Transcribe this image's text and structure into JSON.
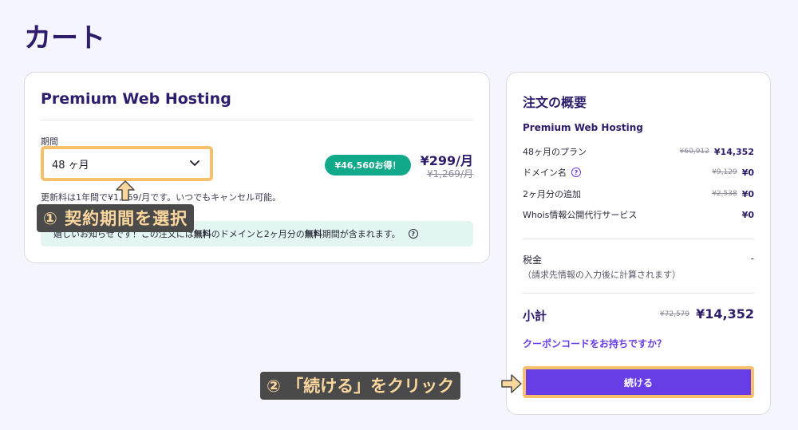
{
  "page": {
    "title": "カート"
  },
  "plan": {
    "title": "Premium Web Hosting",
    "period_label": "期間",
    "period_value": "48 ヶ月",
    "savings_badge": "¥46,560お得！",
    "price_current": "¥299/月",
    "price_original": "¥1,269/月",
    "renewal_note": "更新料は1年間で¥1,269/月です。いつでもキャンセル可能。",
    "banner": {
      "pre": "嬉しいお知らせです！この注文には",
      "bold1": "無料",
      "mid": "のドメインと2ヶ月分の",
      "bold2": "無料",
      "post": "期間が含まれます。"
    }
  },
  "annotations": {
    "step1": "① 契約期間を選択",
    "step2": "② 「続ける」をクリック"
  },
  "summary": {
    "title": "注文の概要",
    "plan_name": "Premium Web Hosting",
    "rows": [
      {
        "label": "48ヶ月のプラン",
        "original": "¥60,912",
        "amount": "¥14,352"
      },
      {
        "label": "ドメイン名",
        "original": "¥9,129",
        "amount": "¥0"
      },
      {
        "label": "2ヶ月分の追加",
        "original": "¥2,538",
        "amount": "¥0"
      },
      {
        "label": "Whois情報公開代行サービス",
        "original": "",
        "amount": "¥0"
      }
    ],
    "tax_label": "税金",
    "tax_value": "-",
    "tax_note": "（請求先情報の入力後に計算されます）",
    "subtotal_label": "小計",
    "subtotal_original": "¥72,579",
    "subtotal_amount": "¥14,352",
    "coupon_link": "クーポンコードをお持ちですか？",
    "continue_button": "続ける"
  },
  "colors": {
    "brand": "#673de6",
    "heading": "#2f1c6a",
    "badge": "#10a98a",
    "highlight": "#f6c16a",
    "background": "#f4f5ff"
  }
}
